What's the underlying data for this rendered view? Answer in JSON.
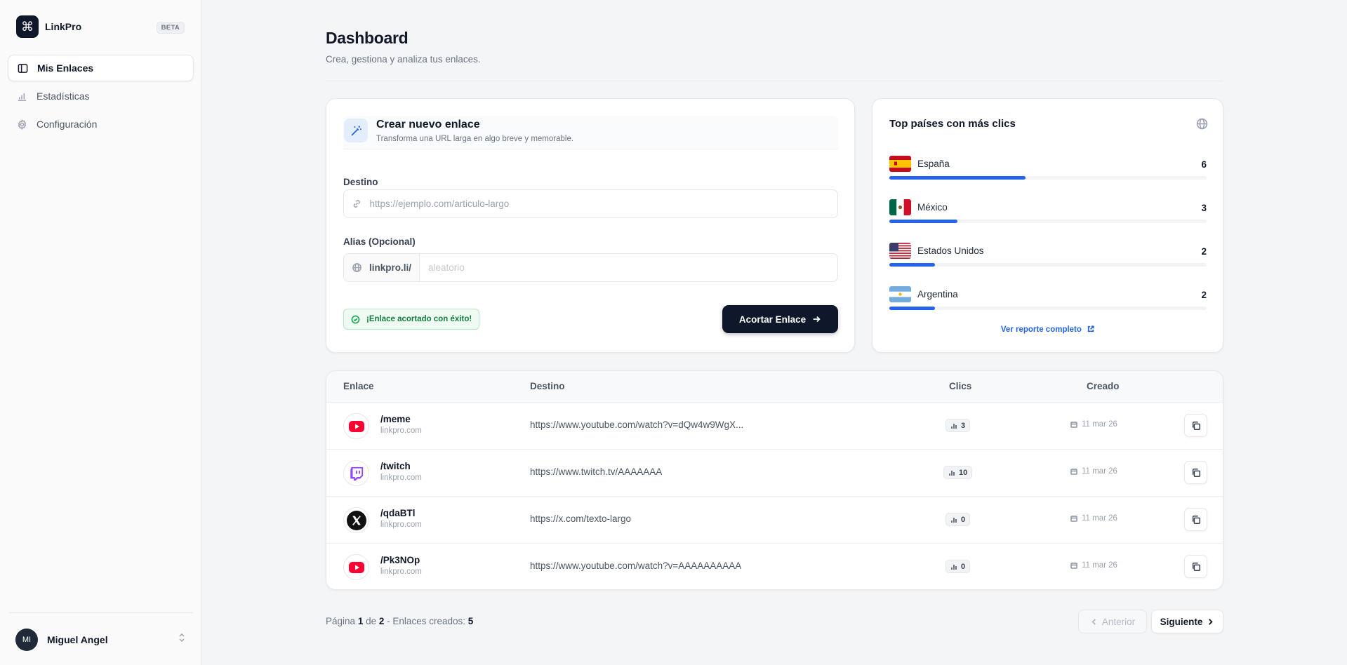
{
  "app": {
    "name": "LinkPro",
    "badge": "BETA",
    "logo_icon": "command-icon"
  },
  "nav": [
    {
      "label": "Mis Enlaces",
      "icon": "sidebar-panel-icon",
      "active": true
    },
    {
      "label": "Estadísticas",
      "icon": "bar-chart-icon",
      "active": false
    },
    {
      "label": "Configuración",
      "icon": "gear-icon",
      "active": false
    }
  ],
  "user": {
    "initials": "MI",
    "name": "Miguel Angel"
  },
  "header": {
    "title": "Dashboard",
    "subtitle": "Crea, gestiona y analiza tus enlaces."
  },
  "create": {
    "title": "Crear nuevo enlace",
    "subtitle": "Transforma una URL larga en algo breve y memorable.",
    "destination_label": "Destino",
    "destination_value": "",
    "destination_placeholder": "https://ejemplo.com/articulo-largo",
    "alias_label": "Alias (Opcional)",
    "alias_prefix": "linkpro.li/",
    "alias_value": "",
    "alias_placeholder": "aleatorio",
    "success_message": "¡Enlace acortado con éxito!",
    "submit_label": "Acortar Enlace"
  },
  "countries": {
    "title": "Top países con más clics",
    "max": 6,
    "items": [
      {
        "name": "España",
        "count": "6",
        "value": 6,
        "flag": "es"
      },
      {
        "name": "México",
        "count": "3",
        "value": 3,
        "flag": "mx"
      },
      {
        "name": "Estados Unidos",
        "count": "2",
        "value": 2,
        "flag": "us"
      },
      {
        "name": "Argentina",
        "count": "2",
        "value": 2,
        "flag": "ar"
      }
    ],
    "report_link": "Ver reporte completo"
  },
  "table": {
    "headers": {
      "link": "Enlace",
      "destination": "Destino",
      "clicks": "Clics",
      "created": "Creado"
    },
    "rows": [
      {
        "alias": "/meme",
        "domain": "linkpro.com",
        "destination": "https://www.youtube.com/watch?v=dQw4w9WgX...",
        "clicks": "3",
        "created": "11 mar 26",
        "icon": "youtube-icon"
      },
      {
        "alias": "/twitch",
        "domain": "linkpro.com",
        "destination": "https://www.twitch.tv/AAAAAAA",
        "clicks": "10",
        "created": "11 mar 26",
        "icon": "twitch-icon"
      },
      {
        "alias": "/qdaBTl",
        "domain": "linkpro.com",
        "destination": "https://x.com/texto-largo",
        "clicks": "0",
        "created": "11 mar 26",
        "icon": "x-logo-icon"
      },
      {
        "alias": "/Pk3NOp",
        "domain": "linkpro.com",
        "destination": "https://www.youtube.com/watch?v=AAAAAAAAAA",
        "clicks": "0",
        "created": "11 mar 26",
        "icon": "youtube-icon"
      }
    ]
  },
  "pagination": {
    "page_word": "Página",
    "current": "1",
    "of_word": "de",
    "total": "2",
    "links_label": "- Enlaces creados:",
    "links_count": "5",
    "prev_label": "Anterior",
    "next_label": "Siguiente"
  },
  "colors": {
    "accent": "#2563eb",
    "primary": "#0f172a",
    "success": "#16a34a"
  }
}
